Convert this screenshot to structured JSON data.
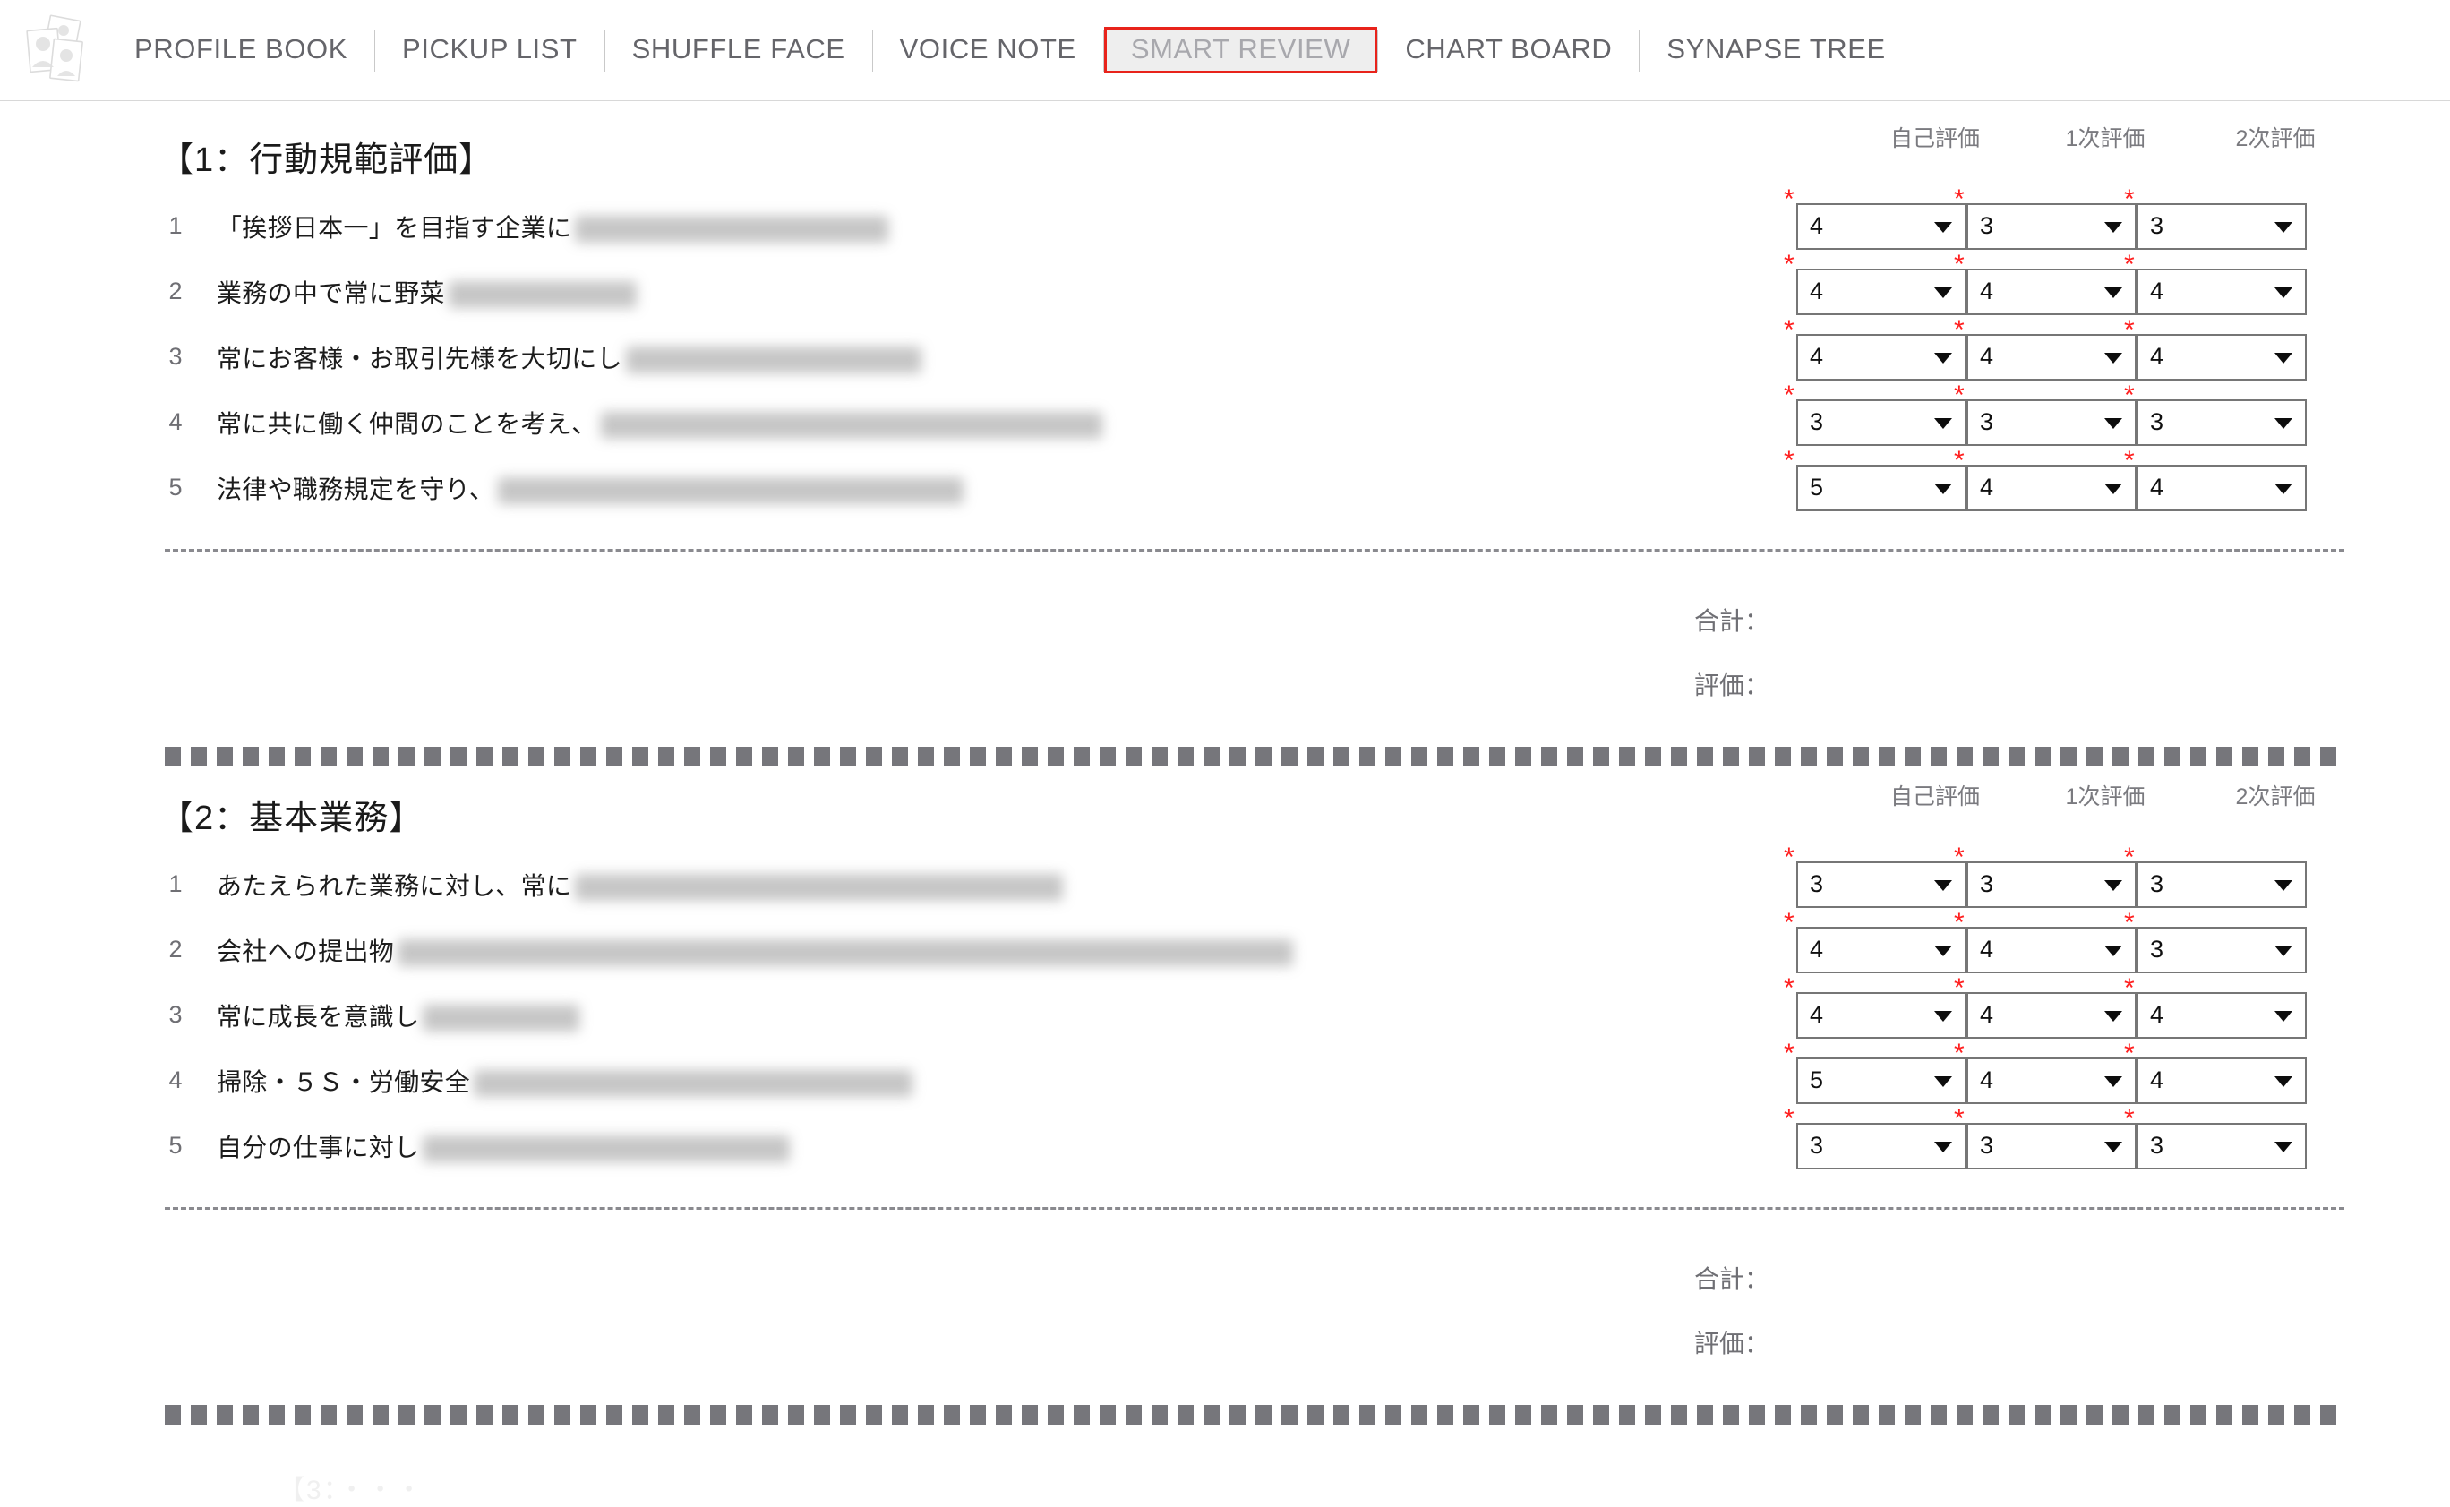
{
  "app": {
    "logo_icon": "photo-cards-stack-icon",
    "accent_red": "#e8231b",
    "nav_text_color": "#65656a"
  },
  "nav": {
    "items": [
      {
        "label": "PROFILE BOOK",
        "active": false
      },
      {
        "label": "PICKUP LIST",
        "active": false
      },
      {
        "label": "SHUFFLE FACE",
        "active": false
      },
      {
        "label": "VOICE NOTE",
        "active": false
      },
      {
        "label": "SMART REVIEW",
        "active": true
      },
      {
        "label": "CHART BOARD",
        "active": false
      },
      {
        "label": "SYNAPSE TREE",
        "active": false
      }
    ]
  },
  "columns": {
    "headers": [
      "自己評価",
      "1次評価",
      "2次評価"
    ]
  },
  "totals_labels": {
    "sum": "合計：",
    "rating": "評価："
  },
  "required_marker": "*",
  "caret_icon": "chevron-down-icon",
  "sections": [
    {
      "title": "【1：行動規範評価】",
      "rows": [
        {
          "num": "1",
          "text": "「挨拶日本一」を目指す企業に",
          "redacted_width": 350
        },
        {
          "num": "2",
          "text": "業務の中で常に野菜",
          "redacted_width": 210
        },
        {
          "num": "3",
          "text": "常にお客様・お取引先様を大切にし",
          "redacted_width": 330
        },
        {
          "num": "4",
          "text": "常に共に働く仲間のことを考え、",
          "redacted_width": 560
        },
        {
          "num": "5",
          "text": "法律や職務規定を守り、",
          "redacted_width": 520
        }
      ],
      "values": [
        [
          "4",
          "3",
          "3"
        ],
        [
          "4",
          "4",
          "4"
        ],
        [
          "4",
          "4",
          "4"
        ],
        [
          "3",
          "3",
          "3"
        ],
        [
          "5",
          "4",
          "4"
        ]
      ],
      "sum": [
        "",
        "",
        ""
      ],
      "rating": [
        "",
        "",
        ""
      ]
    },
    {
      "title": "【2：基本業務】",
      "rows": [
        {
          "num": "1",
          "text": "あたえられた業務に対し、常に",
          "redacted_width": 545
        },
        {
          "num": "2",
          "text": "会社への提出物",
          "redacted_width": 1000
        },
        {
          "num": "3",
          "text": "常に成長を意識し",
          "redacted_width": 175
        },
        {
          "num": "4",
          "text": "掃除・５Ｓ・労働安全",
          "redacted_width": 490
        },
        {
          "num": "5",
          "text": "自分の仕事に対し",
          "redacted_width": 410
        }
      ],
      "values": [
        [
          "3",
          "3",
          "3"
        ],
        [
          "4",
          "4",
          "3"
        ],
        [
          "4",
          "4",
          "4"
        ],
        [
          "5",
          "4",
          "4"
        ],
        [
          "3",
          "3",
          "3"
        ]
      ],
      "sum": [
        "",
        "",
        ""
      ],
      "rating": [
        "",
        "",
        ""
      ]
    }
  ],
  "next_section_partial": "【3：・・・"
}
